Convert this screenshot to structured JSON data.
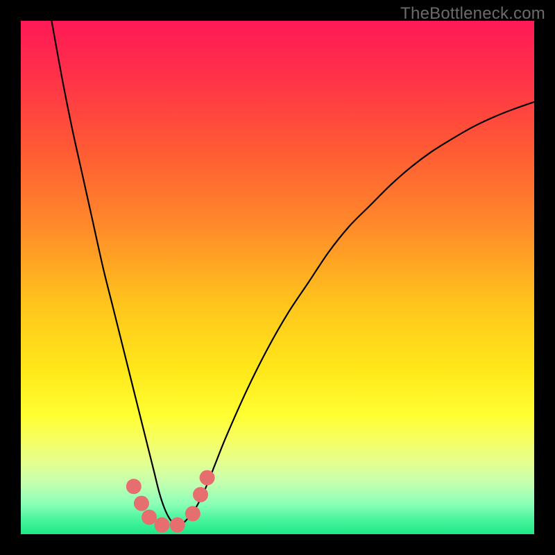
{
  "watermark": "TheBottleneck.com",
  "frame": {
    "outer_size": 800,
    "margin": 30,
    "plot_size": 740,
    "border_color": "#000000"
  },
  "gradient": {
    "stops": [
      {
        "offset": 0.0,
        "color": "#ff1a56"
      },
      {
        "offset": 0.1,
        "color": "#ff2f4a"
      },
      {
        "offset": 0.25,
        "color": "#ff5a34"
      },
      {
        "offset": 0.4,
        "color": "#ff8a2a"
      },
      {
        "offset": 0.55,
        "color": "#ffc41c"
      },
      {
        "offset": 0.68,
        "color": "#ffe81a"
      },
      {
        "offset": 0.77,
        "color": "#ffff33"
      },
      {
        "offset": 0.82,
        "color": "#f5ff66"
      },
      {
        "offset": 0.86,
        "color": "#e4ff8f"
      },
      {
        "offset": 0.9,
        "color": "#c4ffb0"
      },
      {
        "offset": 0.94,
        "color": "#8dffb8"
      },
      {
        "offset": 0.97,
        "color": "#4bf59e"
      },
      {
        "offset": 1.0,
        "color": "#1ee887"
      }
    ]
  },
  "chart_data": {
    "type": "line",
    "title": "",
    "xlabel": "",
    "ylabel": "",
    "xlim": [
      0,
      100
    ],
    "ylim": [
      0,
      100
    ],
    "series": [
      {
        "name": "curve",
        "x": [
          6,
          8,
          10,
          12,
          14,
          16,
          18,
          20,
          22,
          24,
          25,
          26,
          27,
          28,
          29,
          30,
          31,
          32,
          34,
          36,
          38,
          40,
          44,
          48,
          52,
          56,
          60,
          64,
          68,
          72,
          76,
          80,
          84,
          88,
          92,
          96,
          100
        ],
        "y": [
          100,
          89,
          79,
          70,
          61,
          52,
          44,
          36,
          28,
          20,
          16,
          12,
          8,
          5,
          3,
          2,
          2,
          2.5,
          5,
          9,
          14,
          19,
          28,
          36,
          43,
          49,
          55,
          60,
          64,
          68,
          71.5,
          74.5,
          77,
          79.3,
          81.2,
          82.8,
          84.2
        ]
      }
    ],
    "markers": [
      {
        "name": "left-1",
        "x": 22.0,
        "y": 9.3
      },
      {
        "name": "left-2",
        "x": 23.5,
        "y": 6.0
      },
      {
        "name": "left-3",
        "x": 25.0,
        "y": 3.3
      },
      {
        "name": "min-1",
        "x": 27.5,
        "y": 1.8
      },
      {
        "name": "min-2",
        "x": 30.5,
        "y": 1.8
      },
      {
        "name": "right-1",
        "x": 33.5,
        "y": 4.0
      },
      {
        "name": "right-2",
        "x": 35.0,
        "y": 7.7
      },
      {
        "name": "right-3",
        "x": 36.3,
        "y": 11.0
      }
    ],
    "curve_color": "#000000",
    "marker_color": "#e76e6e"
  }
}
